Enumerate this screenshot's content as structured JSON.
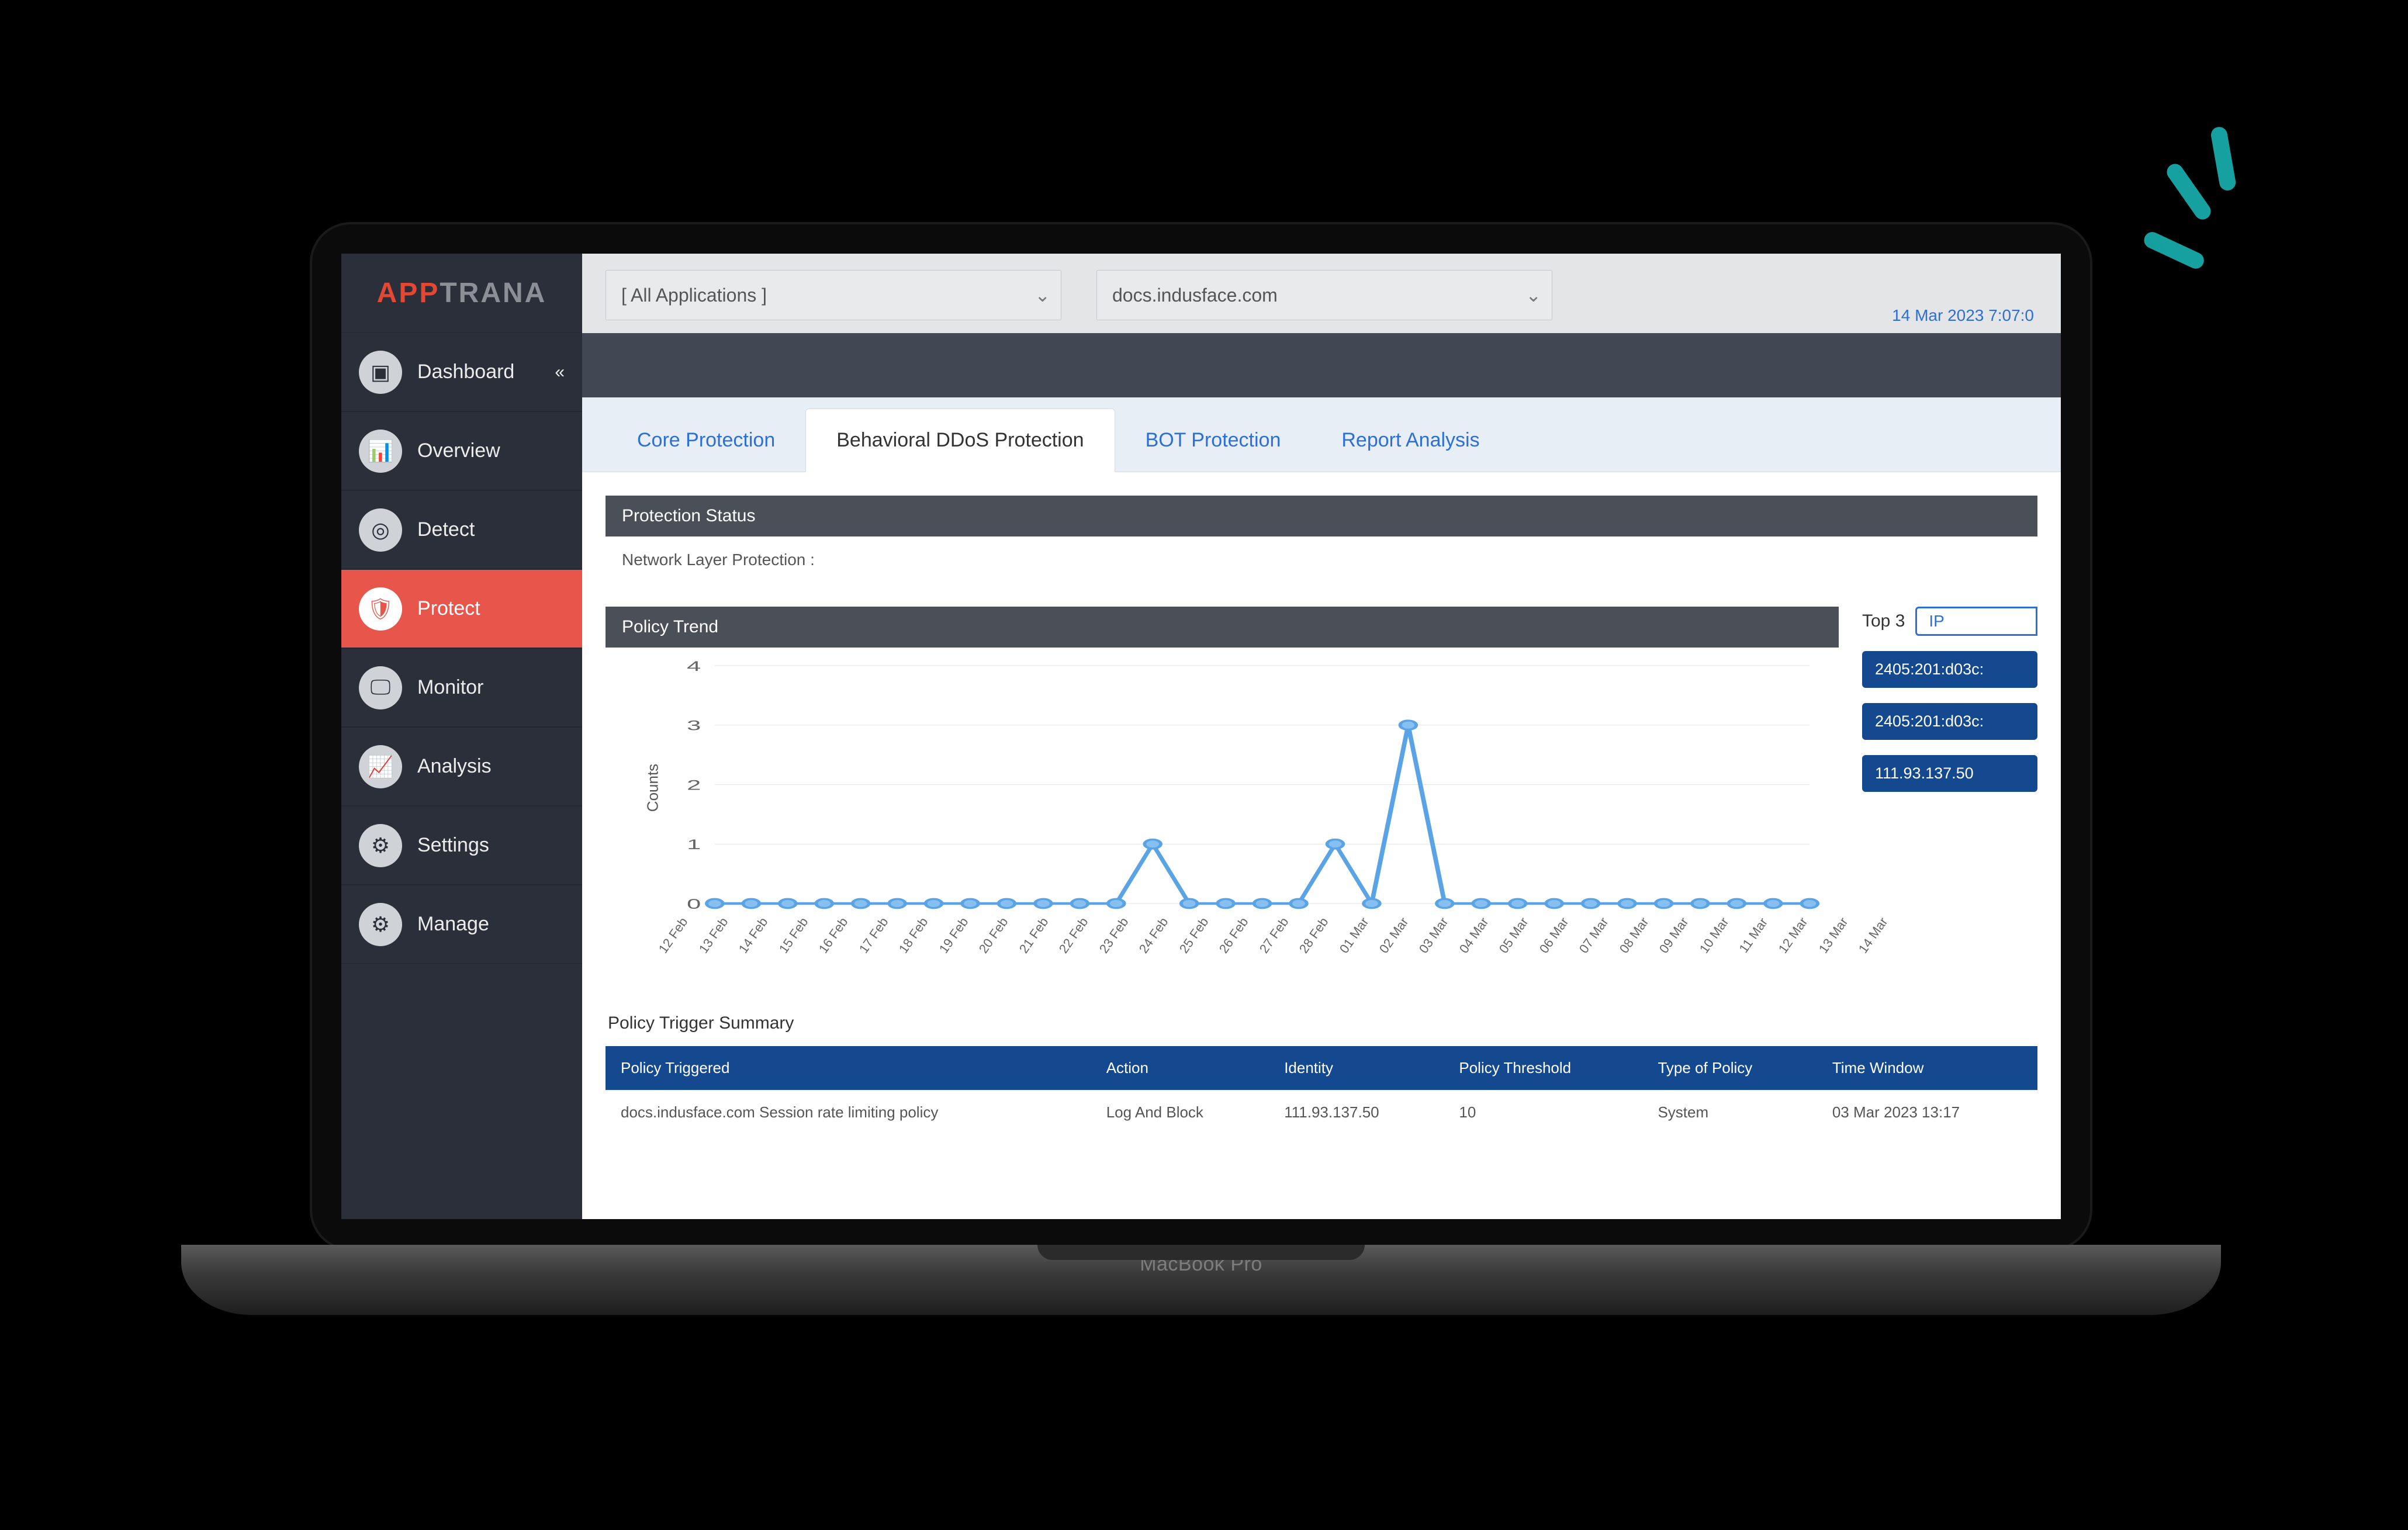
{
  "brand": {
    "part1": "APP",
    "part2": "TRANA"
  },
  "device_label": "MacBook Pro",
  "sidebar": {
    "items": [
      {
        "label": "Dashboard",
        "icon": "dashboard-icon",
        "chevron": true
      },
      {
        "label": "Overview",
        "icon": "overview-icon"
      },
      {
        "label": "Detect",
        "icon": "detect-icon"
      },
      {
        "label": "Protect",
        "icon": "protect-icon",
        "active": true
      },
      {
        "label": "Monitor",
        "icon": "monitor-icon"
      },
      {
        "label": "Analysis",
        "icon": "analysis-icon"
      },
      {
        "label": "Settings",
        "icon": "settings-icon"
      },
      {
        "label": "Manage",
        "icon": "manage-icon"
      }
    ]
  },
  "topbar": {
    "app_filter": "[ All Applications ]",
    "domain_filter": "docs.indusface.com",
    "timestamp": "14 Mar 2023 7:07:0"
  },
  "tabs": [
    {
      "label": "Core Protection"
    },
    {
      "label": "Behavioral DDoS Protection",
      "active": true
    },
    {
      "label": "BOT Protection"
    },
    {
      "label": "Report Analysis"
    }
  ],
  "protection_status": {
    "title": "Protection Status",
    "body": "Network Layer Protection :"
  },
  "policy_trend": {
    "title": "Policy Trend",
    "ylabel": "Counts"
  },
  "top3": {
    "label": "Top 3",
    "selector": "IP",
    "ips": [
      "2405:201:d03c:",
      "2405:201:d03c:",
      "111.93.137.50"
    ]
  },
  "trigger_summary": {
    "title": "Policy Trigger Summary",
    "headers": [
      "Policy Triggered",
      "Action",
      "Identity",
      "Policy Threshold",
      "Type of Policy",
      "Time Window"
    ],
    "rows": [
      [
        "docs.indusface.com Session rate limiting policy",
        "Log And Block",
        "111.93.137.50",
        "10",
        "System",
        "03 Mar 2023 13:17"
      ]
    ]
  },
  "chart_data": {
    "type": "line",
    "title": "Policy Trend",
    "xlabel": "",
    "ylabel": "Counts",
    "ylim": [
      0,
      4
    ],
    "categories": [
      "12 Feb",
      "13 Feb",
      "14 Feb",
      "15 Feb",
      "16 Feb",
      "17 Feb",
      "18 Feb",
      "19 Feb",
      "20 Feb",
      "21 Feb",
      "22 Feb",
      "23 Feb",
      "24 Feb",
      "25 Feb",
      "26 Feb",
      "27 Feb",
      "28 Feb",
      "01 Mar",
      "02 Mar",
      "03 Mar",
      "04 Mar",
      "05 Mar",
      "06 Mar",
      "07 Mar",
      "08 Mar",
      "09 Mar",
      "10 Mar",
      "11 Mar",
      "12 Mar",
      "13 Mar",
      "14 Mar"
    ],
    "values": [
      0,
      0,
      0,
      0,
      0,
      0,
      0,
      0,
      0,
      0,
      0,
      0,
      1,
      0,
      0,
      0,
      0,
      1,
      0,
      3,
      0,
      0,
      0,
      0,
      0,
      0,
      0,
      0,
      0,
      0,
      0
    ]
  }
}
